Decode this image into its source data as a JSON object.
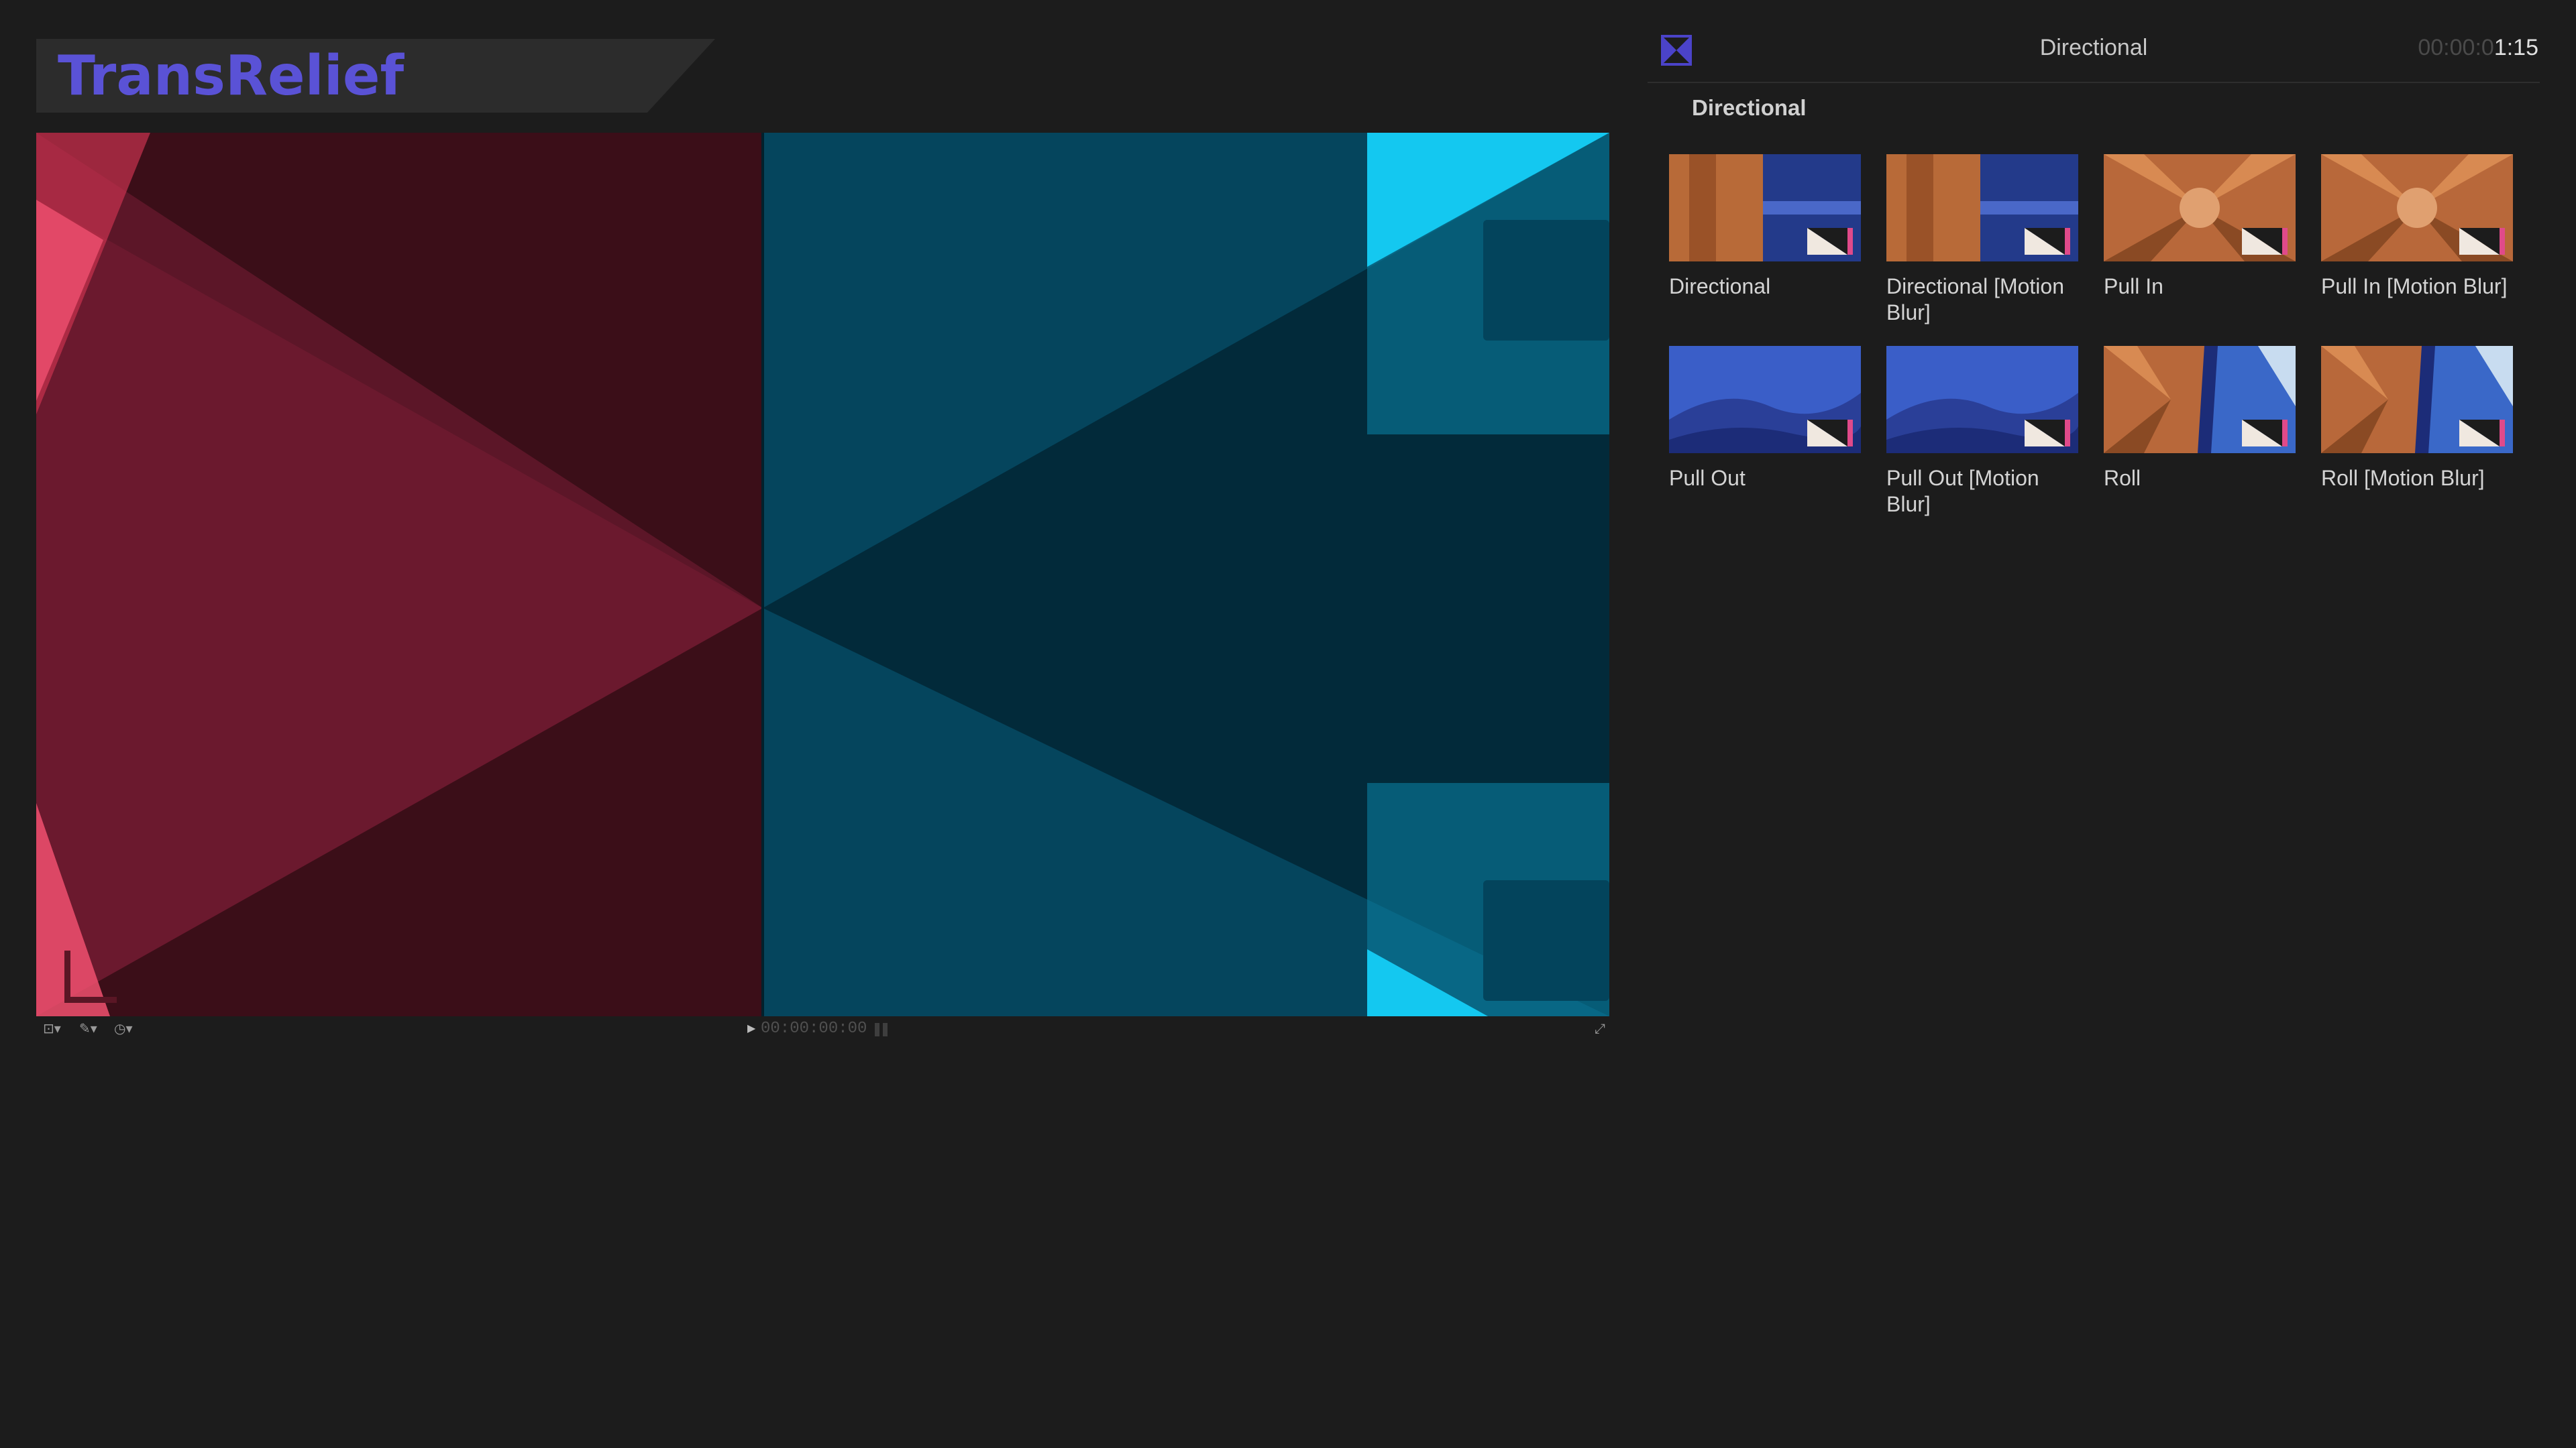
{
  "app": {
    "logo_text": "TransRelief"
  },
  "viewer": {
    "timecode": "00:00:00:00"
  },
  "inspector": {
    "title": "Directional",
    "time_dim": "00:00:0",
    "time_bright": "1:15",
    "section_label": "Directional"
  },
  "presets": [
    {
      "label": "Directional",
      "thumb": "directional"
    },
    {
      "label": "Directional [Motion Blur]",
      "thumb": "directional"
    },
    {
      "label": "Pull In",
      "thumb": "pull-in"
    },
    {
      "label": "Pull In [Motion Blur]",
      "thumb": "pull-in"
    },
    {
      "label": "Pull Out",
      "thumb": "pull-out"
    },
    {
      "label": "Pull Out [Motion Blur]",
      "thumb": "pull-out"
    },
    {
      "label": "Roll",
      "thumb": "roll"
    },
    {
      "label": "Roll [Motion Blur]",
      "thumb": "roll"
    }
  ],
  "colors": {
    "brand": "#5a52d6",
    "red_panel": "#3a0f18",
    "teal_panel": "#03354a",
    "background": "#1c1c1c"
  }
}
